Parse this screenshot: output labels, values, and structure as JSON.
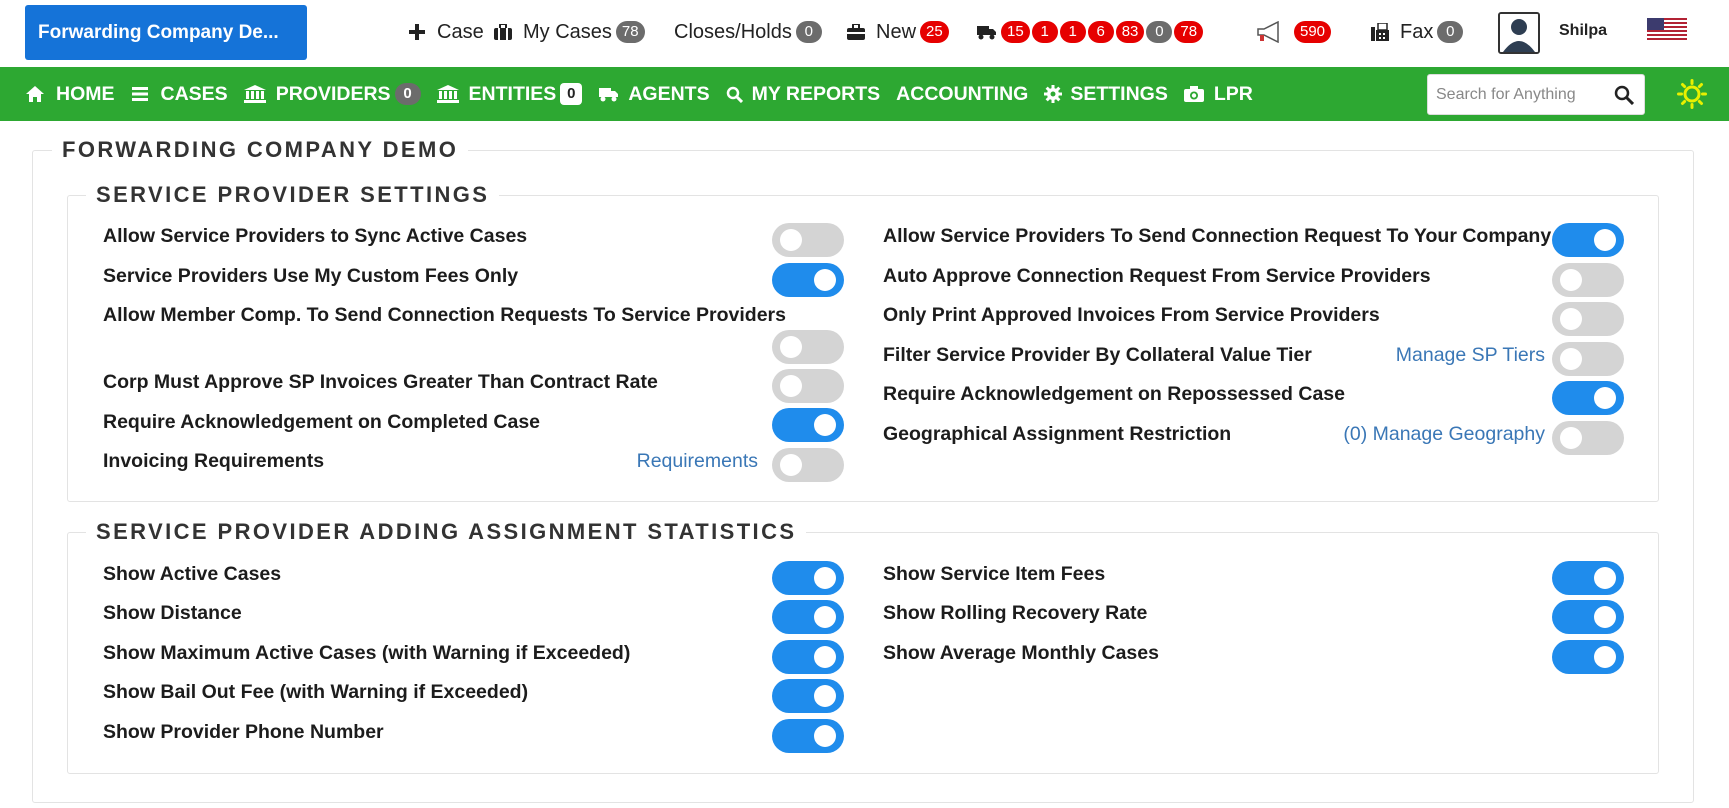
{
  "top": {
    "brand": "Forwarding Company De...",
    "case": "Case",
    "my_cases": "My Cases",
    "my_cases_count": "78",
    "closes_holds": "Closes/Holds",
    "closes_holds_count": "0",
    "new": "New",
    "new_count": "25",
    "truck_counts": [
      "15",
      "1",
      "1",
      "6",
      "83",
      "0",
      "78"
    ],
    "announce_count": "590",
    "fax": "Fax",
    "fax_count": "0",
    "user": "Shilpa"
  },
  "nav": {
    "home": "HOME",
    "cases": "CASES",
    "providers": "PROVIDERS",
    "providers_count": "0",
    "entities": "ENTITIES",
    "entities_count": "0",
    "agents": "AGENTS",
    "my_reports": "MY REPORTS",
    "accounting": "ACCOUNTING",
    "settings": "SETTINGS",
    "lpr": "LPR",
    "search_placeholder": "Search for Anything"
  },
  "page": {
    "title": "FORWARDING COMPANY DEMO"
  },
  "sp_settings": {
    "title": "SERVICE PROVIDER SETTINGS",
    "left": [
      {
        "label": "Allow Service Providers to Sync Active Cases",
        "on": false
      },
      {
        "label": "Service Providers Use My Custom Fees Only",
        "on": true
      },
      {
        "label": "Allow Member Comp. To Send Connection Requests To Service Providers",
        "on": false
      },
      {
        "label": "Corp Must Approve SP Invoices Greater Than Contract Rate",
        "on": false
      },
      {
        "label": "Require Acknowledgement on Completed Case",
        "on": true
      },
      {
        "label": "Invoicing Requirements",
        "on": false,
        "link": "Requirements"
      }
    ],
    "right": [
      {
        "label": "Allow Service Providers To Send Connection Request To Your Company",
        "on": true
      },
      {
        "label": "Auto Approve Connection Request From Service Providers",
        "on": false
      },
      {
        "label": "Only Print Approved Invoices From Service Providers",
        "on": false
      },
      {
        "label": "Filter Service Provider By Collateral Value Tier",
        "on": false,
        "link": "Manage SP Tiers"
      },
      {
        "label": "Require Acknowledgement on Repossessed Case",
        "on": true
      },
      {
        "label": "Geographical Assignment Restriction",
        "on": false,
        "link": "(0) Manage Geography"
      }
    ]
  },
  "sp_stats": {
    "title": "SERVICE PROVIDER ADDING ASSIGNMENT STATISTICS",
    "left": [
      {
        "label": "Show Active Cases",
        "on": true
      },
      {
        "label": "Show Distance",
        "on": true
      },
      {
        "label": "Show Maximum Active Cases (with Warning if Exceeded)",
        "on": true
      },
      {
        "label": "Show Bail Out Fee (with Warning if Exceeded)",
        "on": true
      },
      {
        "label": "Show Provider Phone Number",
        "on": true
      }
    ],
    "right": [
      {
        "label": "Show Service Item Fees",
        "on": true
      },
      {
        "label": "Show Rolling Recovery Rate",
        "on": true
      },
      {
        "label": "Show Average Monthly Cases",
        "on": true
      }
    ]
  },
  "colors": {
    "brand_blue": "#1573d8",
    "nav_green": "#2da832",
    "toggle_on": "#1f8cec",
    "toggle_off": "#d4d4d4",
    "badge_red": "#e60000",
    "link": "#3a77b6"
  },
  "icons": [
    "plus-icon",
    "briefcase-icon",
    "truck-icon",
    "megaphone-icon",
    "fax-icon",
    "home-icon",
    "menu-icon",
    "bank-icon",
    "search-icon",
    "gear-icon",
    "camera-icon",
    "sun-icon"
  ]
}
